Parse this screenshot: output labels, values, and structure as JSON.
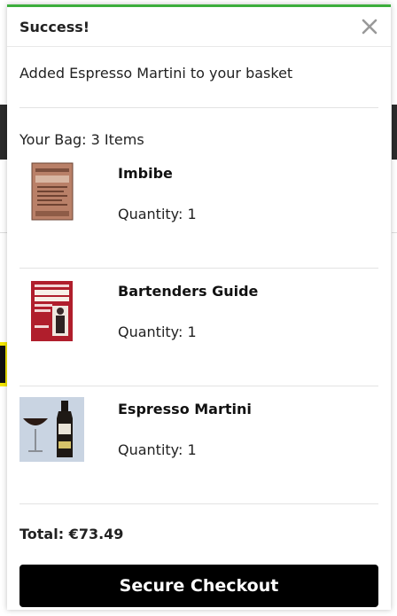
{
  "modal": {
    "title": "Success!",
    "close_icon": "close-icon",
    "message": "Added Espresso Martini to your basket",
    "bag_title": "Your Bag: 3 Items",
    "items": [
      {
        "name": "Imbibe",
        "quantity": "Quantity: 1",
        "thumbnail": "book-cover-imbibe"
      },
      {
        "name": "Bartenders Guide",
        "quantity": "Quantity: 1",
        "thumbnail": "book-cover-bartenders-guide"
      },
      {
        "name": "Espresso Martini",
        "quantity": "Quantity: 1",
        "thumbnail": "espresso-martini-bottle-and-glass"
      }
    ],
    "total": "Total: €73.49",
    "checkout_label": "Secure Checkout"
  },
  "colors": {
    "accent_success": "#3cae3c",
    "checkout_bg": "#000000",
    "checkout_text": "#ffffff"
  }
}
